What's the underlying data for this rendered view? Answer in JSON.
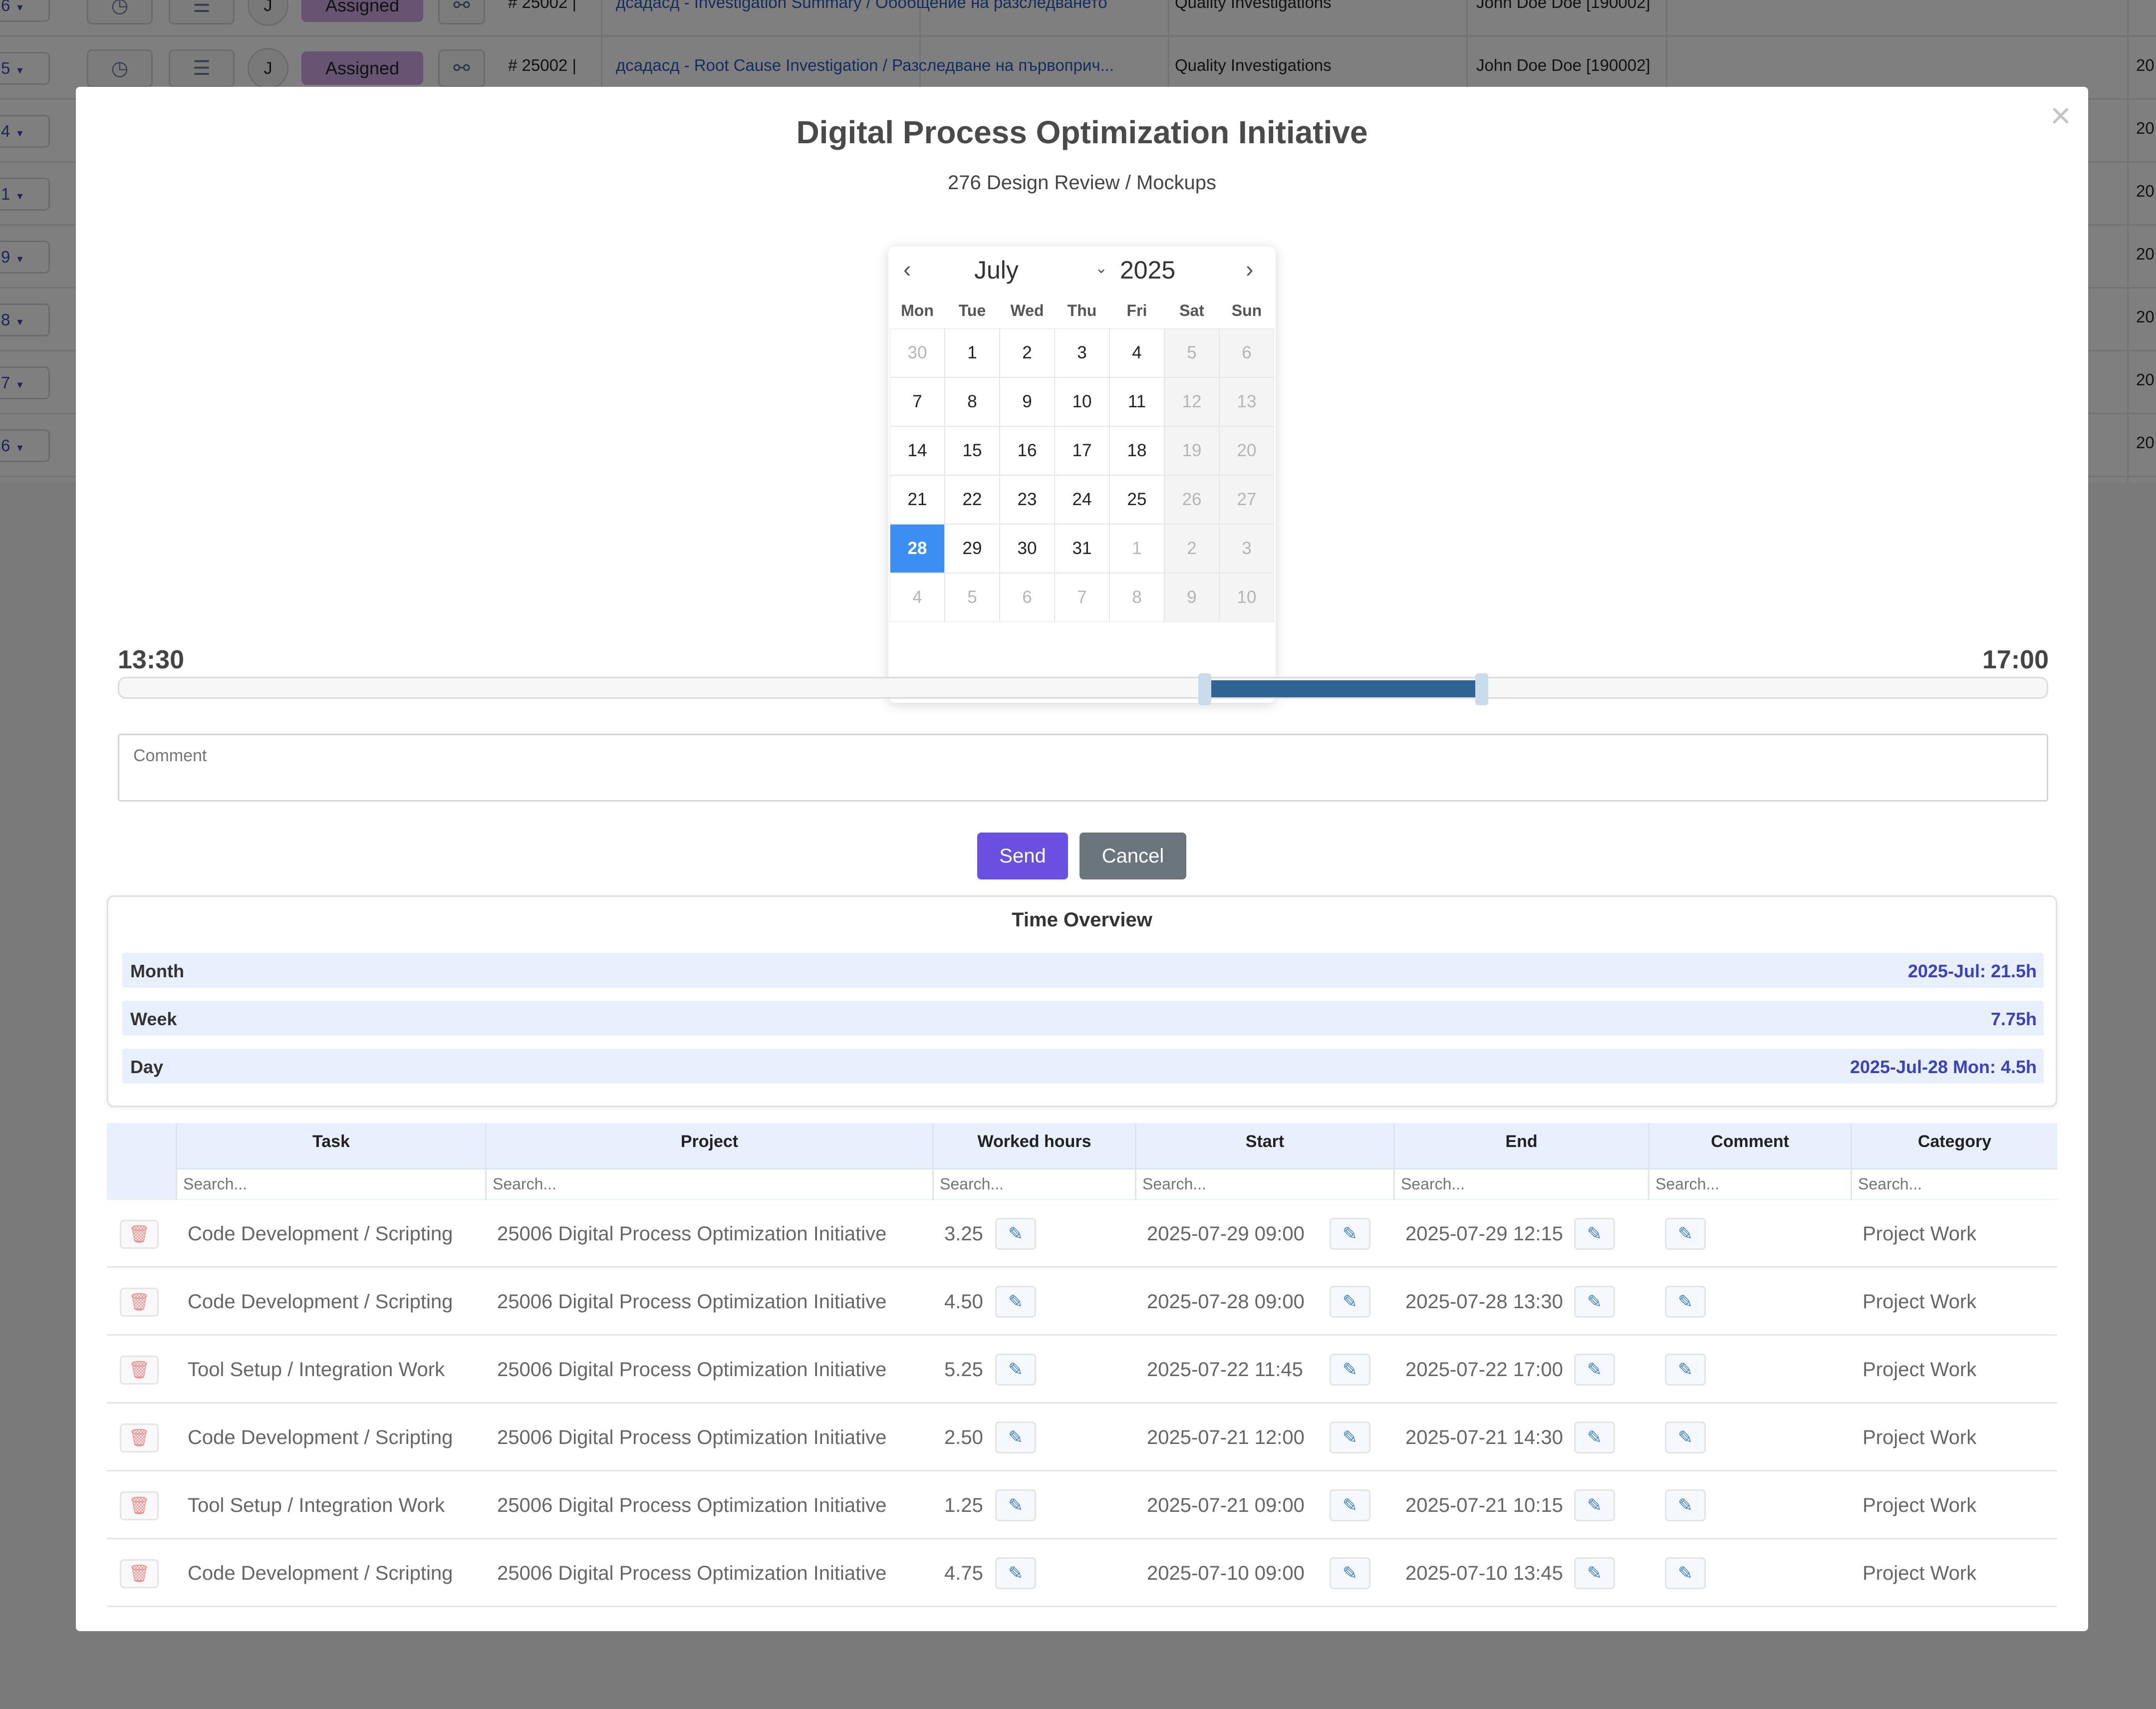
{
  "background": {
    "rows": [
      {
        "num": "6",
        "code": "# 25002 |",
        "link": "дсадасд - Investigation Summary / Обобщение на разследването",
        "status": "Assigned",
        "avatar": "J",
        "category": "Quality Investigations",
        "person": "John Doe Doe [190002]",
        "year": ""
      },
      {
        "num": "5",
        "code": "# 25002 |",
        "link": "дсадасд - Root Cause Investigation / Разследване на първоприч...",
        "status": "Assigned",
        "avatar": "J",
        "category": "Quality Investigations",
        "person": "John Doe Doe [190002]",
        "year": "20"
      },
      {
        "num": "4",
        "year": "20"
      },
      {
        "num": "1",
        "year": "20"
      },
      {
        "num": "9",
        "year": "20"
      },
      {
        "num": "8",
        "year": "20"
      },
      {
        "num": "7",
        "year": "20"
      },
      {
        "num": "6",
        "year": "20"
      }
    ]
  },
  "modal": {
    "title": "Digital Process Optimization Initiative",
    "subtitle": "276 Design Review / Mockups",
    "close_label": "×"
  },
  "calendar": {
    "month": "July",
    "year": "2025",
    "weekdays": [
      "Mon",
      "Tue",
      "Wed",
      "Thu",
      "Fri",
      "Sat",
      "Sun"
    ],
    "weeks": [
      [
        "30",
        "1",
        "2",
        "3",
        "4",
        "5",
        "6"
      ],
      [
        "7",
        "8",
        "9",
        "10",
        "11",
        "12",
        "13"
      ],
      [
        "14",
        "15",
        "16",
        "17",
        "18",
        "19",
        "20"
      ],
      [
        "21",
        "22",
        "23",
        "24",
        "25",
        "26",
        "27"
      ],
      [
        "28",
        "29",
        "30",
        "31",
        "1",
        "2",
        "3"
      ],
      [
        "4",
        "5",
        "6",
        "7",
        "8",
        "9",
        "10"
      ]
    ],
    "selected": "28"
  },
  "time_range": {
    "start_label": "13:30",
    "end_label": "17:00",
    "range_start_fraction": 0.563,
    "range_end_fraction": 0.705
  },
  "comment": {
    "placeholder": "Comment"
  },
  "buttons": {
    "send": "Send",
    "cancel": "Cancel"
  },
  "overview": {
    "title": "Time Overview",
    "rows": [
      {
        "label": "Month",
        "value": "2025-Jul: 21.5h"
      },
      {
        "label": "Week",
        "value": "7.75h"
      },
      {
        "label": "Day",
        "value": "2025-Jul-28 Mon: 4.5h"
      }
    ]
  },
  "table": {
    "columns": [
      "Task",
      "Project",
      "Worked hours",
      "Start",
      "End",
      "Comment",
      "Category"
    ],
    "search_placeholder": "Search...",
    "rows": [
      {
        "task": "Code Development / Scripting",
        "project": "25006 Digital Process Optimization Initiative",
        "hours": "3.25",
        "start": "2025-07-29 09:00",
        "end": "2025-07-29 12:15",
        "category": "Project Work"
      },
      {
        "task": "Code Development / Scripting",
        "project": "25006 Digital Process Optimization Initiative",
        "hours": "4.50",
        "start": "2025-07-28 09:00",
        "end": "2025-07-28 13:30",
        "category": "Project Work"
      },
      {
        "task": "Tool Setup / Integration Work",
        "project": "25006 Digital Process Optimization Initiative",
        "hours": "5.25",
        "start": "2025-07-22 11:45",
        "end": "2025-07-22 17:00",
        "category": "Project Work"
      },
      {
        "task": "Code Development / Scripting",
        "project": "25006 Digital Process Optimization Initiative",
        "hours": "2.50",
        "start": "2025-07-21 12:00",
        "end": "2025-07-21 14:30",
        "category": "Project Work"
      },
      {
        "task": "Tool Setup / Integration Work",
        "project": "25006 Digital Process Optimization Initiative",
        "hours": "1.25",
        "start": "2025-07-21 09:00",
        "end": "2025-07-21 10:15",
        "category": "Project Work"
      },
      {
        "task": "Code Development / Scripting",
        "project": "25006 Digital Process Optimization Initiative",
        "hours": "4.75",
        "start": "2025-07-10 09:00",
        "end": "2025-07-10 13:45",
        "category": "Project Work"
      }
    ]
  }
}
